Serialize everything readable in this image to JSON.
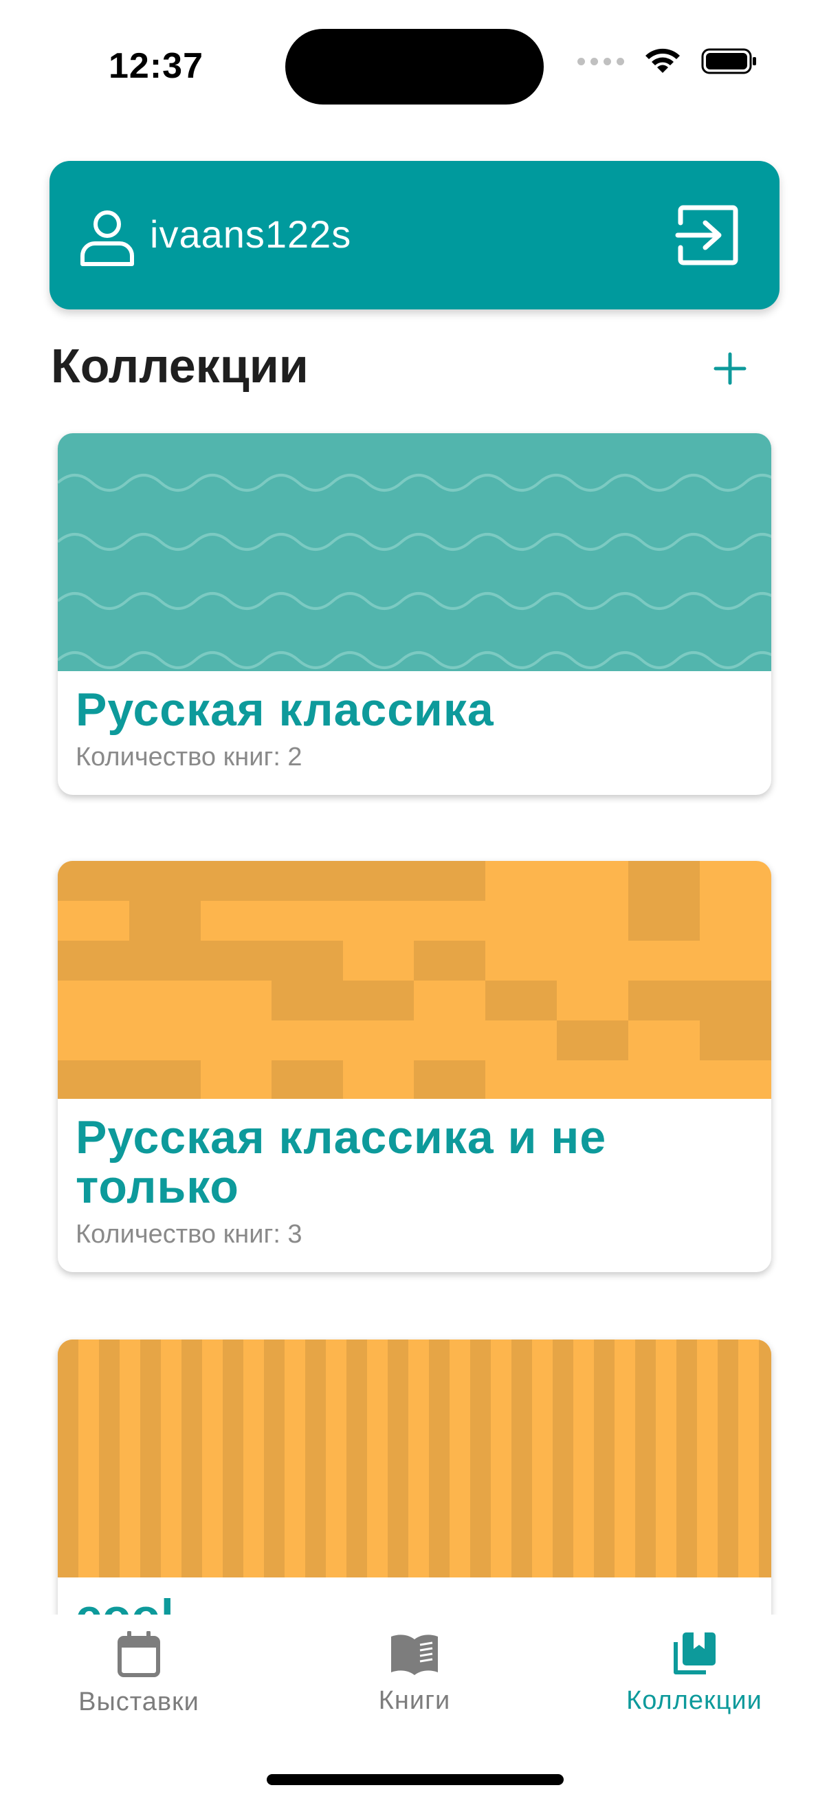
{
  "status_bar": {
    "time": "12:37"
  },
  "user": {
    "username": "ivaans122s",
    "icon": "user-icon",
    "logout_icon": "logout-icon"
  },
  "section": {
    "title": "Коллекции",
    "add_icon": "plus-icon"
  },
  "collections": [
    {
      "title": "Русская классика",
      "count_text": "Количество книг: 2",
      "cover_pattern": "waves",
      "cover_color": "#52b5ad"
    },
    {
      "title": "Русская классика и не только",
      "count_text": "Количество книг: 3",
      "cover_pattern": "blocks",
      "cover_color": "#fdb54d"
    },
    {
      "title": "cool",
      "count_text": "",
      "cover_pattern": "stripes",
      "cover_color": "#fdb54d"
    }
  ],
  "tab_bar": {
    "tabs": [
      {
        "label": "Выставки",
        "icon": "calendar-icon",
        "active": false
      },
      {
        "label": "Книги",
        "icon": "book-open-icon",
        "active": false
      },
      {
        "label": "Коллекции",
        "icon": "collections-icon",
        "active": true
      }
    ]
  },
  "colors": {
    "accent": "#009a9d",
    "title_teal": "#0d9a9b",
    "orange": "#fdb54d",
    "orange_dark": "#e6a546",
    "teal_cover": "#52b5ad"
  }
}
